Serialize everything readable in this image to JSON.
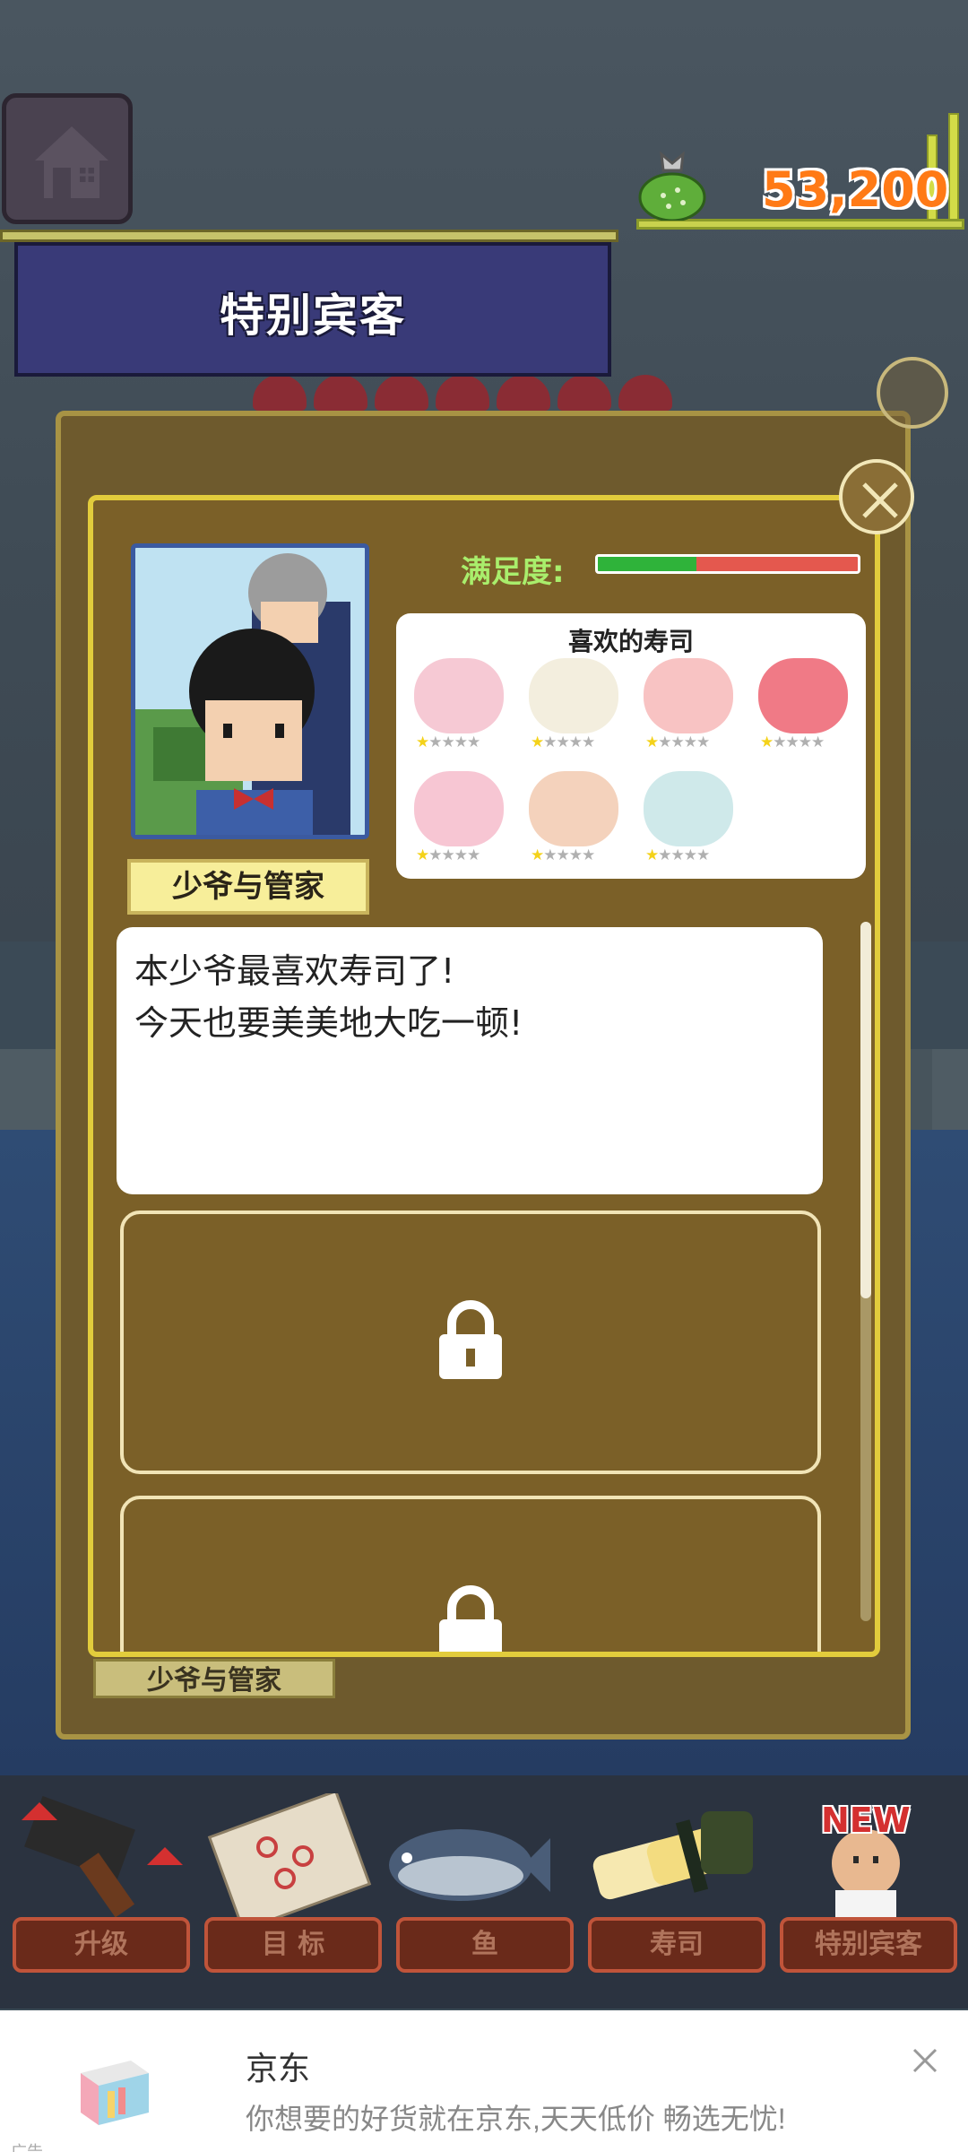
{
  "top_bar": {
    "home_icon": "house-icon",
    "money": "53,200",
    "money_icon": "money-bag-icon"
  },
  "banner": {
    "title": "特别宾客"
  },
  "guest_card": {
    "name": "少爷与管家",
    "satisfaction_label": "满足度:",
    "satisfaction_fraction": 0.38,
    "favorite_sushi_title": "喜欢的寿司",
    "favorite_sushi": [
      {
        "icon": "pink-shrimp-sushi-icon",
        "color": "#f6c9d4",
        "stars": 1
      },
      {
        "icon": "white-squid-sushi-icon",
        "color": "#f3eede",
        "stars": 1
      },
      {
        "icon": "salmon-roll-sushi-icon",
        "color": "#f8c3c3",
        "stars": 1
      },
      {
        "icon": "tuna-sushi-icon",
        "color": "#f07a86",
        "stars": 1
      },
      {
        "icon": "shrimp-sushi-icon",
        "color": "#f7c6d3",
        "stars": 1
      },
      {
        "icon": "eel-sushi-icon",
        "color": "#f4d2bc",
        "stars": 1
      },
      {
        "icon": "cucumber-sushi-icon",
        "color": "#cfe9ea",
        "stars": 1
      }
    ],
    "quote_lines": [
      "本少爷最喜欢寿司了!",
      "今天也要美美地大吃一顿!"
    ],
    "locked_icon": "padlock-icon"
  },
  "back_card": {
    "name": "少爷与管家"
  },
  "bottom_nav": {
    "items": [
      {
        "label": "升级",
        "icon": "hammer-icon"
      },
      {
        "label": "目  标",
        "icon": "target-sheet-icon"
      },
      {
        "label": "鱼",
        "icon": "fish-icon"
      },
      {
        "label": "寿司",
        "icon": "sushi-icon"
      },
      {
        "label": "特别宾客",
        "icon": "guest-icon"
      }
    ],
    "new_badge": "NEW"
  },
  "ad": {
    "title": "京东",
    "description": "你想要的好货就在京东,天天低价 畅选无忧!",
    "tag": "广告"
  },
  "colors": {
    "accent_money": "#ff7a16",
    "satisfaction_green": "#2fb33a",
    "satisfaction_red": "#e4584e"
  }
}
